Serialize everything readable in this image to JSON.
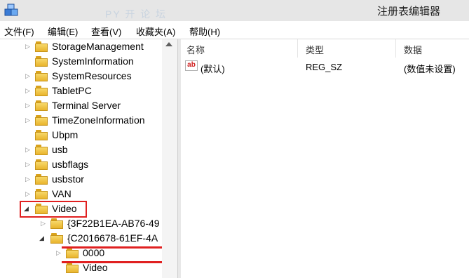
{
  "window": {
    "title": "注册表编辑器",
    "watermark": "PY 开 论 坛"
  },
  "menu": [
    {
      "label": "文件(F)"
    },
    {
      "label": "编辑(E)"
    },
    {
      "label": "查看(V)"
    },
    {
      "label": "收藏夹(A)"
    },
    {
      "label": "帮助(H)"
    }
  ],
  "tree": {
    "nodes": [
      {
        "label": "StorageManagement",
        "expander": "▷"
      },
      {
        "label": "SystemInformation",
        "expander": ""
      },
      {
        "label": "SystemResources",
        "expander": "▷"
      },
      {
        "label": "TabletPC",
        "expander": "▷"
      },
      {
        "label": "Terminal Server",
        "expander": "▷"
      },
      {
        "label": "TimeZoneInformation",
        "expander": "▷"
      },
      {
        "label": "Ubpm",
        "expander": ""
      },
      {
        "label": "usb",
        "expander": "▷"
      },
      {
        "label": "usbflags",
        "expander": "▷"
      },
      {
        "label": "usbstor",
        "expander": "▷"
      },
      {
        "label": "VAN",
        "expander": "▷"
      },
      {
        "label": "Video",
        "expander": "◢"
      },
      {
        "label": "{3F22B1EA-AB76-49",
        "expander": "▷"
      },
      {
        "label": "{C2016678-61EF-4A",
        "expander": "◢"
      },
      {
        "label": "0000",
        "expander": "▷"
      },
      {
        "label": "Video",
        "expander": ""
      }
    ]
  },
  "list": {
    "columns": [
      "名称",
      "类型",
      "数据"
    ],
    "rows": [
      {
        "icon": "ab",
        "name": "(默认)",
        "type": "REG_SZ",
        "data": "(数值未设置)"
      }
    ]
  },
  "colors": {
    "highlight": "#e02020",
    "folder": "#f2c94c",
    "titlebar": "#e6e6e6"
  }
}
